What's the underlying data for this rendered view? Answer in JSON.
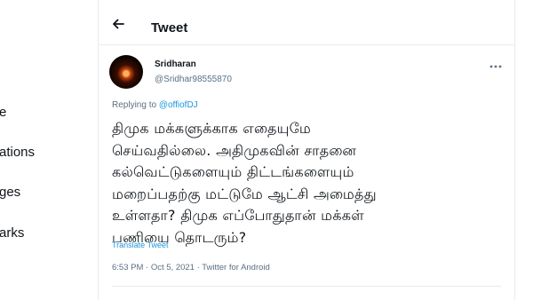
{
  "nav": {
    "items": [
      "e",
      "ations",
      "ges",
      "arks"
    ]
  },
  "header": {
    "title": "Tweet",
    "back_icon": "back-arrow-icon"
  },
  "tweet": {
    "author_name": "Sridharan",
    "author_handle": "@Sridhar98555870",
    "replying_prefix": "Replying to",
    "replying_mention": "@offiofDJ",
    "text_lines": [
      "திமுக மக்களுக்காக எதையுமே",
      "செய்வதில்லை. அதிமுகவின் சாதனை",
      "கல்வெட்டுகளையும் திட்டங்களையும்",
      "மறைப்பதற்கு மட்டுமே ஆட்சி அமைத்து",
      "உள்ளதா? திமுக எப்போதுதான் மக்கள்",
      "பணியை தொடரும்?"
    ],
    "translate_label": "Translate Tweet",
    "time": "6:53 PM",
    "date": "Oct 5, 2021",
    "source": "Twitter for Android",
    "separator": "·"
  },
  "colors": {
    "link": "#1b95e0",
    "secondary_text": "#5b7083",
    "border": "#e6ecf0"
  }
}
